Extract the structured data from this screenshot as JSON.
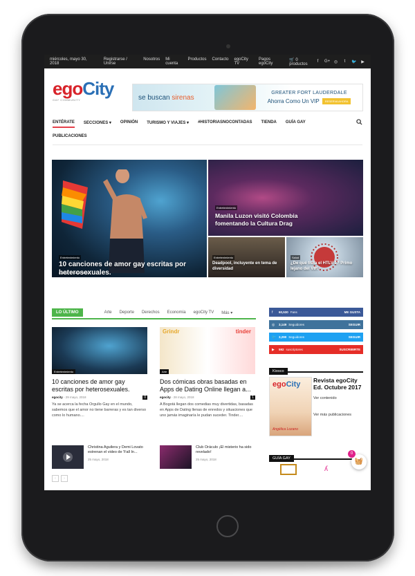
{
  "topbar": {
    "date": "miércoles, mayo 30, 2018",
    "links": [
      "Registrarse / Unirse",
      "Nosotros",
      "Mi cuenta",
      "Productos",
      "Contacto",
      "egoCity TV",
      "Pagos egoCity",
      "🛒 0 productos"
    ],
    "social_icons": [
      "facebook-icon",
      "google-plus-icon",
      "instagram-icon",
      "tumblr-icon",
      "twitter-icon",
      "youtube-icon"
    ]
  },
  "logo": {
    "ego": "ego",
    "city": "City",
    "tag": "GAY COMMUNITY"
  },
  "banner": {
    "line1_pre": "se buscan ",
    "line1_hl": "sirenas",
    "line2": "GREATER FORT LAUDERDALE",
    "line3": "Ahorra Como Un VIP",
    "cta": "RESERVA AHORA"
  },
  "nav": {
    "items": [
      "ENTÉRATE",
      "SECCIONES ▾",
      "OPINIÓN",
      "TURISMO Y VIAJES ▾",
      "#HISTORIASNOCONTADAS",
      "TIENDA",
      "GUÍA GAY"
    ],
    "items_row2": [
      "PUBLICACIONES"
    ],
    "search_icon": "search-icon"
  },
  "hero": {
    "main": {
      "category": "Entretenimiento",
      "title": "10 canciones de amor gay escritas por heterosexuales.",
      "author": "egocity",
      "date": "29 mayo, 2018"
    },
    "top_right": {
      "category": "Entretenimiento",
      "title": "Manila Luzon visitó Colombia fomentando la Cultura Drag"
    },
    "bottom_left": {
      "category": "Entretenimiento",
      "title": "Deadpool, incluyente en tema de diversidad"
    },
    "bottom_right": {
      "category": "Salud",
      "title": "¿De qué trata el HTLV-1? Primo lejano del VIH"
    }
  },
  "latest": {
    "label": "LO ÚLTIMO",
    "tabs": [
      "Arte",
      "Deporte",
      "Derechos",
      "Economía",
      "egoCity TV",
      "Más ▾"
    ],
    "cards": [
      {
        "category": "Entretenimiento",
        "title": "10 canciones de amor gay escritas por heterosexuales.",
        "author": "egocity",
        "date": "29 mayo, 2018",
        "count": "0",
        "excerpt": "Ya se acerca la fecha Orgullo Gay en el mundo, sabemos que el amor no tiene barreras y es tan diverso como lo humano...."
      },
      {
        "category": "Arte",
        "title": "Dos cómicas obras basadas en Apps de Dating Online llegan a...",
        "author": "egocity",
        "date": "28 mayo, 2018",
        "count": "1",
        "excerpt": "A Bogotá llegan dos comedias muy divertidas, basadas en Apps de Dating llenas de enredos y situaciones que uno jamás imaginaría le pudan suceder. Tinder...."
      }
    ],
    "small": [
      {
        "title": "Christina Aguilera y Demi Lovato estrenan el video de 'Fall In...",
        "date": "25 mayo, 2018"
      },
      {
        "title": "Club Oráculo ¡El misterio ha sido revelado!",
        "date": "25 mayo, 2018"
      }
    ],
    "pager": [
      "‹",
      "›"
    ]
  },
  "sidebar": {
    "social": [
      {
        "num": "60,530",
        "label": "Fans",
        "action": "ME GUSTA",
        "icon": "facebook-icon"
      },
      {
        "num": "3,149",
        "label": "Seguidores",
        "action": "SEGUIR",
        "icon": "instagram-icon"
      },
      {
        "num": "3,290",
        "label": "Seguidores",
        "action": "SEGUIR",
        "icon": "twitter-icon"
      },
      {
        "num": "592",
        "label": "suscriptores",
        "action": "SUSCRIBIRTE",
        "icon": "youtube-icon"
      }
    ],
    "kiosco": {
      "heading": "Kiosco",
      "title": "Revista egoCity Ed. Octubre 2017",
      "link1": "Ver contenido",
      "link2": "Ver más publicaciones",
      "cover_name": "Angélica Lozano"
    },
    "guia_heading": "GUÍA GAY"
  },
  "cart": {
    "count": "0"
  }
}
